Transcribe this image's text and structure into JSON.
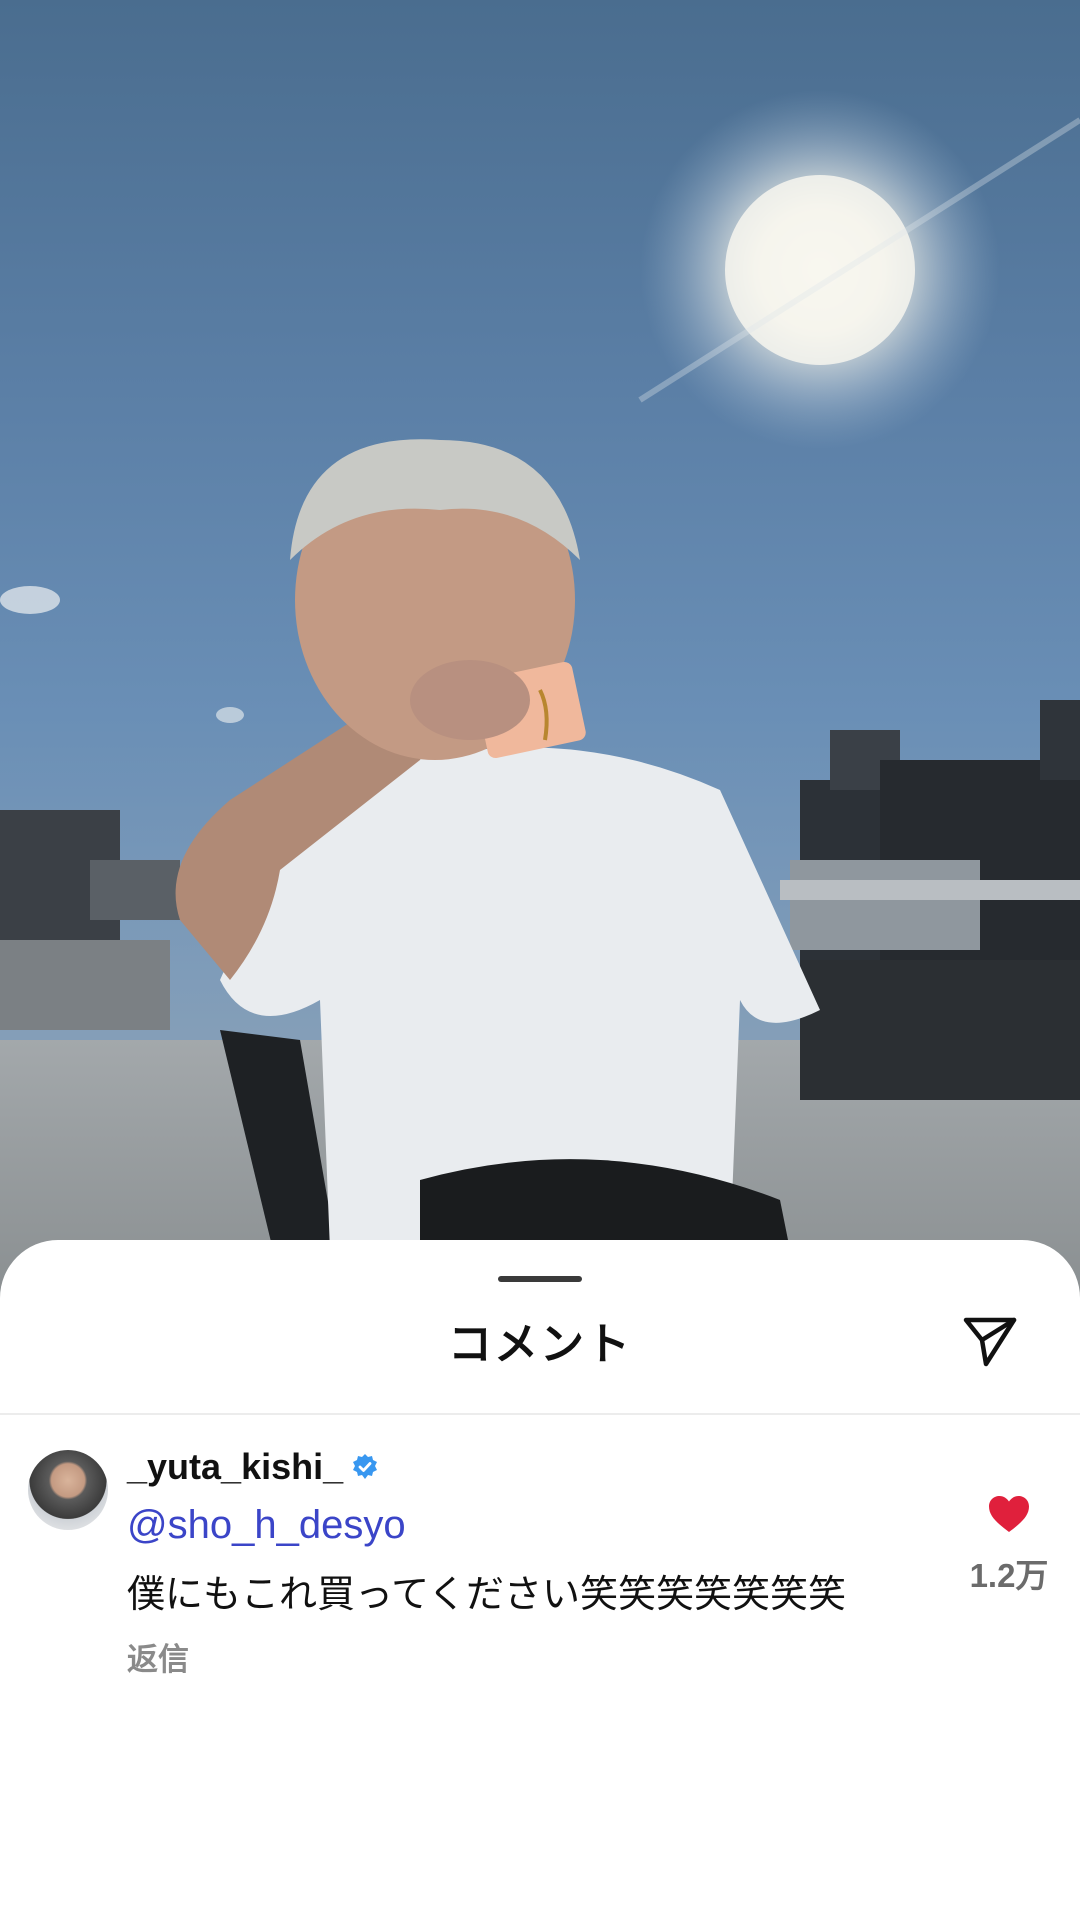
{
  "post_image": {
    "icon": "photo",
    "subject": "person in white t-shirt holding pink box on sunny rooftop"
  },
  "sheet": {
    "title": "コメント",
    "share_icon": "paper-plane-icon"
  },
  "comment": {
    "username": "_yuta_kishi_",
    "verified_icon": "verified-badge-icon",
    "mention": "@sho_h_desyo",
    "text": "僕にもこれ買ってください笑笑笑笑笑笑笑",
    "reply_label": "返信",
    "like_icon": "heart-icon",
    "like_count": "1.2万"
  },
  "colors": {
    "mention": "#3b45c8",
    "like": "#e0203c",
    "verified": "#3897f0"
  }
}
